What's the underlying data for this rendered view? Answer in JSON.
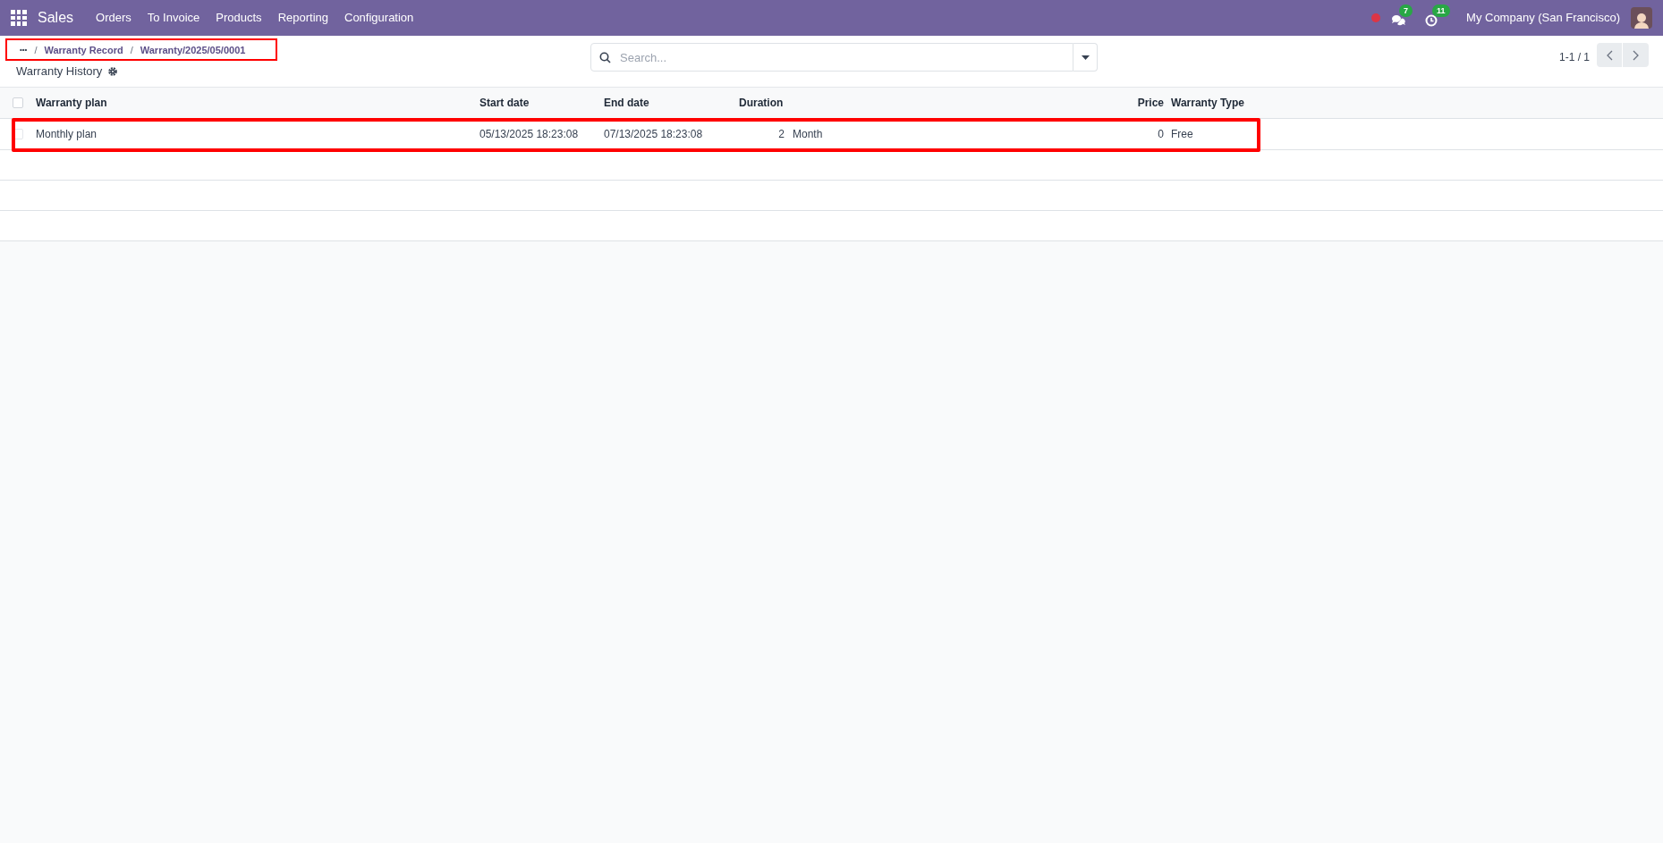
{
  "navbar": {
    "app": "Sales",
    "menu": [
      "Orders",
      "To Invoice",
      "Products",
      "Reporting",
      "Configuration"
    ],
    "messages_badge": "7",
    "activities_badge": "11",
    "company": "My Company (San Francisco)"
  },
  "breadcrumb": {
    "more": "•••",
    "separator": "/",
    "items": [
      "Warranty Record",
      "Warranty/2025/05/0001"
    ]
  },
  "title": "Warranty History",
  "search": {
    "placeholder": "Search..."
  },
  "pager": "1-1 / 1",
  "table": {
    "all_selected": false,
    "columns": [
      "Warranty plan",
      "Start date",
      "End date",
      "Duration",
      "Price",
      "Warranty Type"
    ],
    "rows": [
      {
        "plan": "Monthly plan",
        "start": "05/13/2025 18:23:08",
        "end": "07/13/2025 18:23:08",
        "duration": "2",
        "unit": "Month",
        "price": "0",
        "type": "Free",
        "checked": false
      }
    ]
  }
}
